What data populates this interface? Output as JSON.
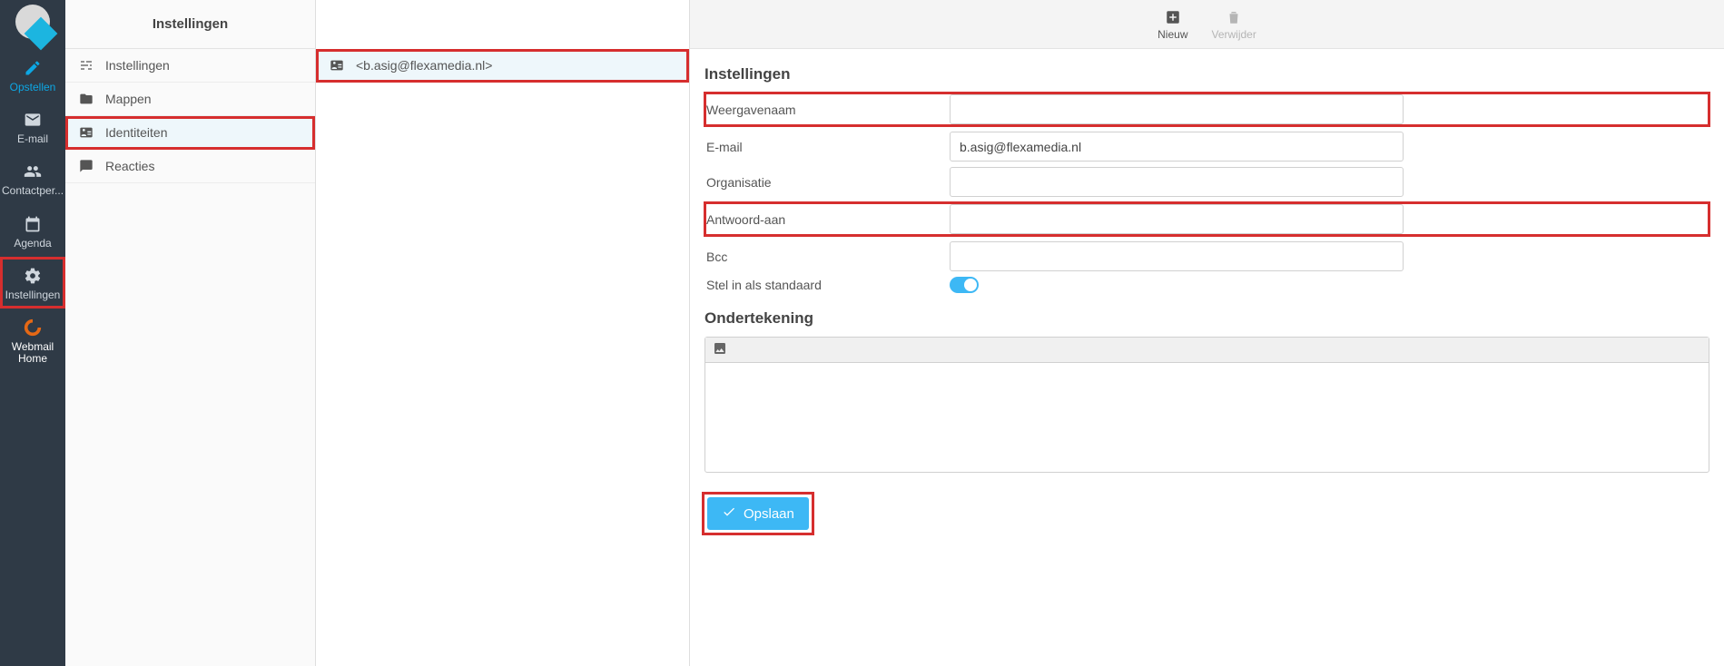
{
  "sidebar": {
    "items": [
      {
        "id": "compose",
        "label": "Opstellen"
      },
      {
        "id": "email",
        "label": "E-mail"
      },
      {
        "id": "contacts",
        "label": "Contactper..."
      },
      {
        "id": "agenda",
        "label": "Agenda"
      },
      {
        "id": "settings",
        "label": "Instellingen"
      },
      {
        "id": "webmail",
        "label": "Webmail Home"
      }
    ]
  },
  "settings_menu": {
    "title": "Instellingen",
    "items": [
      {
        "id": "prefs",
        "label": "Instellingen"
      },
      {
        "id": "folders",
        "label": "Mappen"
      },
      {
        "id": "identities",
        "label": "Identiteiten"
      },
      {
        "id": "responses",
        "label": "Reacties"
      }
    ]
  },
  "identities": {
    "selected_label": "<b.asig@flexamedia.nl>"
  },
  "toolbar": {
    "new_label": "Nieuw",
    "delete_label": "Verwijder"
  },
  "form": {
    "section_title": "Instellingen",
    "fields": {
      "display_name": {
        "label": "Weergavenaam",
        "value": ""
      },
      "email": {
        "label": "E-mail",
        "value": "b.asig@flexamedia.nl"
      },
      "organisation": {
        "label": "Organisatie",
        "value": ""
      },
      "reply_to": {
        "label": "Antwoord-aan",
        "value": ""
      },
      "bcc": {
        "label": "Bcc",
        "value": ""
      },
      "set_default": {
        "label": "Stel in als standaard",
        "value": true
      }
    },
    "signature_title": "Ondertekening",
    "save_label": "Opslaan"
  }
}
